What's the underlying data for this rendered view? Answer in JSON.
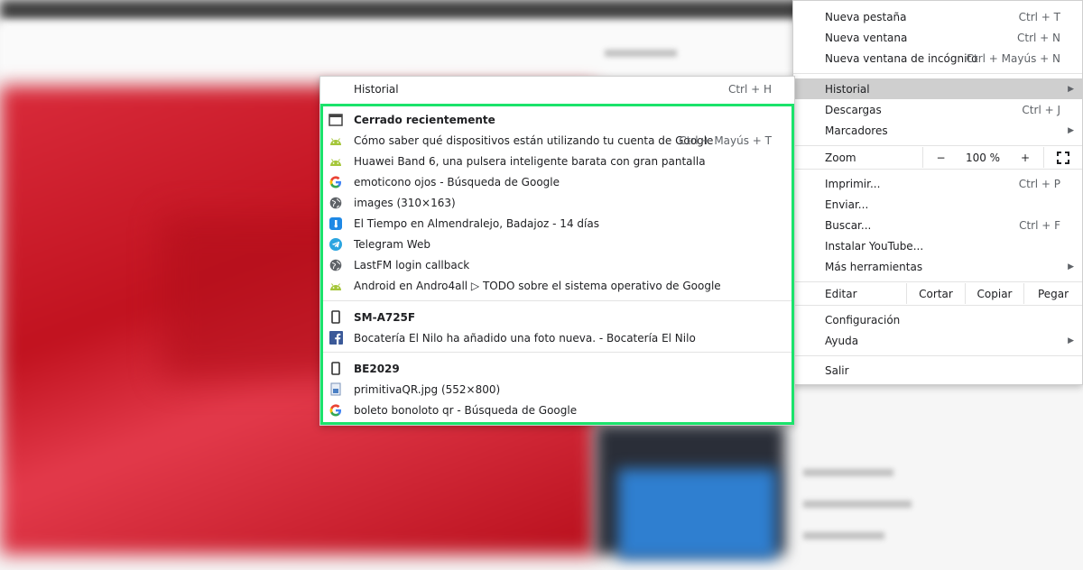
{
  "main_menu": {
    "new_tab": {
      "label": "Nueva pestaña",
      "shortcut": "Ctrl + T"
    },
    "new_window": {
      "label": "Nueva ventana",
      "shortcut": "Ctrl + N"
    },
    "incognito": {
      "label": "Nueva ventana de incógnito",
      "shortcut": "Ctrl + Mayús + N"
    },
    "history": {
      "label": "Historial"
    },
    "downloads": {
      "label": "Descargas",
      "shortcut": "Ctrl + J"
    },
    "bookmarks": {
      "label": "Marcadores"
    },
    "zoom": {
      "label": "Zoom",
      "minus": "−",
      "value": "100 %",
      "plus": "+"
    },
    "print": {
      "label": "Imprimir...",
      "shortcut": "Ctrl + P"
    },
    "cast": {
      "label": "Enviar..."
    },
    "find": {
      "label": "Buscar...",
      "shortcut": "Ctrl + F"
    },
    "install": {
      "label": "Instalar YouTube..."
    },
    "more_tools": {
      "label": "Más herramientas"
    },
    "edit": {
      "label": "Editar",
      "cut": "Cortar",
      "copy": "Copiar",
      "paste": "Pegar"
    },
    "settings": {
      "label": "Configuración"
    },
    "help": {
      "label": "Ayuda"
    },
    "exit": {
      "label": "Salir"
    }
  },
  "history_menu": {
    "history": {
      "label": "Historial",
      "shortcut": "Ctrl + H"
    },
    "recent_header": "Cerrado recientemente",
    "recent_items": [
      {
        "label": "Cómo saber qué dispositivos están utilizando tu cuenta de Google",
        "shortcut": "Ctrl + Mayús + T",
        "icon": "android-icon"
      },
      {
        "label": "Huawei Band 6, una pulsera inteligente barata con gran pantalla",
        "icon": "android-icon"
      },
      {
        "label": "emoticono ojos - Búsqueda de Google",
        "icon": "google-icon"
      },
      {
        "label": "images (310×163)",
        "icon": "globe-icon"
      },
      {
        "label": "El Tiempo en Almendralejo, Badajoz - 14 días",
        "icon": "weather-icon"
      },
      {
        "label": "Telegram Web",
        "icon": "telegram-icon"
      },
      {
        "label": "LastFM login callback",
        "icon": "globe-icon"
      },
      {
        "label": "Android en Andro4all ▷ TODO sobre el sistema operativo de Google",
        "icon": "android-icon"
      }
    ],
    "device1": {
      "name": "SM-A725F",
      "items": [
        {
          "label": "Bocatería El Nilo ha añadido una foto nueva. - Bocatería El Nilo",
          "icon": "facebook-icon"
        }
      ]
    },
    "device2": {
      "name": "BE2029",
      "items": [
        {
          "label": "primitivaQR.jpg (552×800)",
          "icon": "image-file-icon"
        },
        {
          "label": "boleto bonoloto qr - Búsqueda de Google",
          "icon": "google-icon"
        }
      ]
    }
  },
  "colors": {
    "highlight": "#1be36b",
    "android": "#a4c639",
    "facebook": "#3b5998",
    "telegram": "#2ca5e0"
  }
}
